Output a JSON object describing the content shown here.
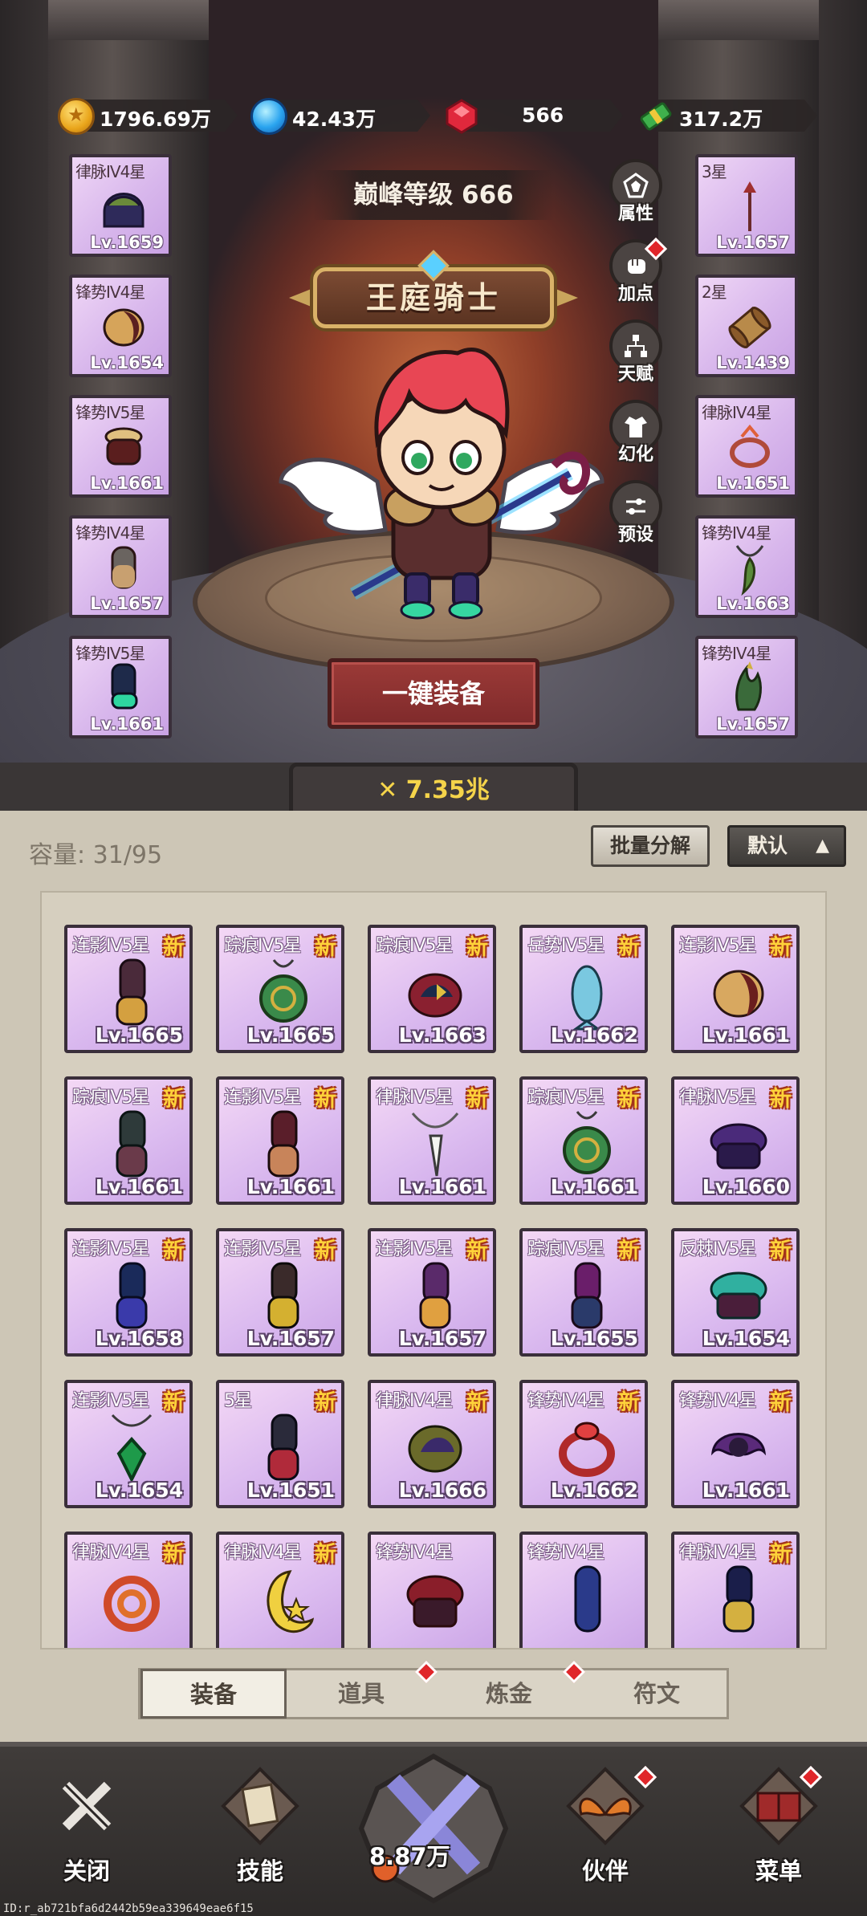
{
  "currency": [
    {
      "icon": "gold-coin-icon",
      "value": "1796.69万"
    },
    {
      "icon": "blue-gem-icon",
      "value": "42.43万"
    },
    {
      "icon": "ruby-icon",
      "value": "566"
    },
    {
      "icon": "cash-bundle-icon",
      "value": "317.2万"
    }
  ],
  "hero": {
    "peak_level": "巅峰等级 666",
    "title": "王庭骑士",
    "power": "7.35兆"
  },
  "left_slots": [
    {
      "name": "律脉IV4星",
      "level": "Lv.1659",
      "art": "helmet"
    },
    {
      "name": "锋势IV4星",
      "level": "Lv.1654",
      "art": "shoulder"
    },
    {
      "name": "锋势IV5星",
      "level": "Lv.1661",
      "art": "belt"
    },
    {
      "name": "锋势IV4星",
      "level": "Lv.1657",
      "art": "leg"
    },
    {
      "name": "锋势IV5星",
      "level": "Lv.1661",
      "art": "boot"
    }
  ],
  "right_slots": [
    {
      "name": "3星",
      "level": "Lv.1657",
      "art": "spear"
    },
    {
      "name": "2星",
      "level": "Lv.1439",
      "art": "scroll"
    },
    {
      "name": "律脉IV4星",
      "level": "Lv.1651",
      "art": "ring"
    },
    {
      "name": "锋势IV4星",
      "level": "Lv.1663",
      "art": "necklace"
    },
    {
      "name": "锋势IV4星",
      "level": "Lv.1657",
      "art": "claw"
    }
  ],
  "side_buttons": [
    {
      "label": "属性",
      "icon": "attributes-icon",
      "badge": false
    },
    {
      "label": "加点",
      "icon": "fist-icon",
      "badge": true
    },
    {
      "label": "天赋",
      "icon": "talent-tree-icon",
      "badge": false
    },
    {
      "label": "幻化",
      "icon": "costume-icon",
      "badge": false
    },
    {
      "label": "预设",
      "icon": "preset-sliders-icon",
      "badge": false
    }
  ],
  "equip_all_label": "一键装备",
  "bag": {
    "capacity": "容量: 31/95",
    "batch_label": "批量分解",
    "sort_label": "默认",
    "new_label": "新",
    "items": [
      {
        "name": "连影IV5星",
        "level": "Lv.1665",
        "new": true,
        "art": "boot-purple"
      },
      {
        "name": "踪痕IV5星",
        "level": "Lv.1665",
        "new": true,
        "art": "amulet-green"
      },
      {
        "name": "踪痕IV5星",
        "level": "Lv.1663",
        "new": true,
        "art": "shoulder-red"
      },
      {
        "name": "岳势IV5星",
        "level": "Lv.1662",
        "new": true,
        "art": "fish"
      },
      {
        "name": "连影IV5星",
        "level": "Lv.1661",
        "new": true,
        "art": "shoulder-tan"
      },
      {
        "name": "踪痕IV5星",
        "level": "Lv.1661",
        "new": true,
        "art": "boot-dark"
      },
      {
        "name": "连影IV5星",
        "level": "Lv.1661",
        "new": true,
        "art": "boot-maroon"
      },
      {
        "name": "律脉IV5星",
        "level": "Lv.1661",
        "new": true,
        "art": "fang-necklace"
      },
      {
        "name": "踪痕IV5星",
        "level": "Lv.1661",
        "new": true,
        "art": "amulet-green"
      },
      {
        "name": "律脉IV5星",
        "level": "Lv.1660",
        "new": true,
        "art": "hat-purple"
      },
      {
        "name": "连影IV5星",
        "level": "Lv.1658",
        "new": true,
        "art": "boot-navy"
      },
      {
        "name": "连影IV5星",
        "level": "Lv.1657",
        "new": true,
        "art": "boot-gold"
      },
      {
        "name": "连影IV5星",
        "level": "Lv.1657",
        "new": true,
        "art": "boot-orange"
      },
      {
        "name": "踪痕IV5星",
        "level": "Lv.1655",
        "new": true,
        "art": "boot-magenta"
      },
      {
        "name": "反棘IV5星",
        "level": "Lv.1654",
        "new": true,
        "art": "hat-teal"
      },
      {
        "name": "连影IV5星",
        "level": "Lv.1654",
        "new": true,
        "art": "emerald-necklace"
      },
      {
        "name": "5星",
        "level": "Lv.1651",
        "new": true,
        "art": "boot-red"
      },
      {
        "name": "律脉IV4星",
        "level": "Lv.1666",
        "new": true,
        "art": "shoulder-olive"
      },
      {
        "name": "锋势IV4星",
        "level": "Lv.1662",
        "new": true,
        "art": "ring-red"
      },
      {
        "name": "锋势IV4星",
        "level": "Lv.1661",
        "new": true,
        "art": "crab-shoulder"
      },
      {
        "name": "律脉IV4星",
        "level": "",
        "new": true,
        "art": "spiral-ring"
      },
      {
        "name": "律脉IV4星",
        "level": "",
        "new": true,
        "art": "crescent"
      },
      {
        "name": "锋势IV4星",
        "level": "",
        "new": false,
        "art": "hat-red"
      },
      {
        "name": "锋势IV4星",
        "level": "",
        "new": false,
        "art": "boot-blue"
      },
      {
        "name": "律脉IV4星",
        "level": "",
        "new": true,
        "art": "boot-navy-gold"
      }
    ]
  },
  "tabs": [
    {
      "label": "装备",
      "active": true,
      "badge": false
    },
    {
      "label": "道具",
      "active": false,
      "badge": true
    },
    {
      "label": "炼金",
      "active": false,
      "badge": true
    },
    {
      "label": "符文",
      "active": false,
      "badge": false
    }
  ],
  "nav": {
    "close": "关闭",
    "skills": "技能",
    "battle_value": "8.87万",
    "partner": "伙伴",
    "menu": "菜单"
  },
  "footer_id": "ID:r_ab721bfa6d2442b59ea339649eae6f15",
  "colors": {
    "rarity_bg": "#dcbcf0",
    "new_badge": "#ffd23a",
    "power_text": "#f5d44a",
    "equip_button": "#9b3a37",
    "red_dot": "#e0262a"
  }
}
